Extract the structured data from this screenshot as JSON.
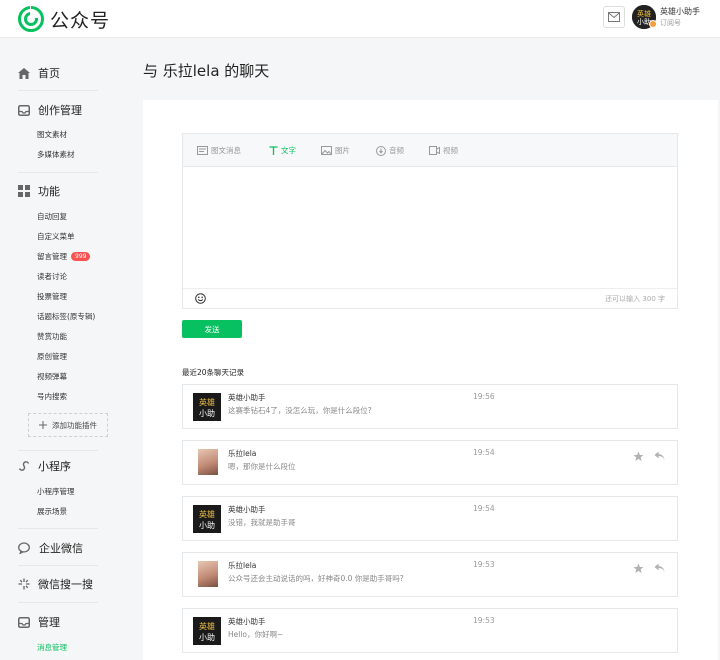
{
  "header": {
    "logo_text": "公众号",
    "account_name": "英雄小助手",
    "account_type": "订阅号",
    "avatar_text": "英雄小助手"
  },
  "sidebar": {
    "home": "首页",
    "create": {
      "title": "创作管理",
      "items": [
        "图文素材",
        "多媒体素材"
      ]
    },
    "features": {
      "title": "功能",
      "items": [
        "自动回复",
        "自定义菜单",
        "留言管理",
        "读者讨论",
        "投票管理",
        "话题标签(原专辑)",
        "赞赏功能",
        "原创管理",
        "视频弹幕",
        "号内搜索"
      ],
      "badge": "999",
      "add_plugin": "添加功能插件"
    },
    "miniprogram": {
      "title": "小程序",
      "items": [
        "小程序管理",
        "展示场景"
      ]
    },
    "wecom": "企业微信",
    "search": "微信搜一搜",
    "manage": {
      "title": "管理",
      "items": [
        "消息管理"
      ]
    }
  },
  "page": {
    "title": "与 乐拉lela 的聊天"
  },
  "editor": {
    "tabs": [
      "图文消息",
      "文字",
      "图片",
      "音频",
      "视频"
    ],
    "active_tab": "文字",
    "counter": "还可以输入 300 字",
    "send_label": "发送"
  },
  "history": {
    "title": "最近20条聊天记录",
    "messages": [
      {
        "sender": "英雄小助手",
        "text": "这赛季钻石4了，没怎么玩，你是什么段位?",
        "time": "19:56",
        "type": "bot"
      },
      {
        "sender": "乐拉lela",
        "text": "嗯，那你是什么段位",
        "time": "19:54",
        "type": "user"
      },
      {
        "sender": "英雄小助手",
        "text": "没错，我就是助手哥",
        "time": "19:54",
        "type": "bot"
      },
      {
        "sender": "乐拉lela",
        "text": "公众号还会主动说话的吗，好神奇0.0 你是助手哥吗?",
        "time": "19:53",
        "type": "user"
      },
      {
        "sender": "英雄小助手",
        "text": "Hello，你好啊~",
        "time": "19:53",
        "type": "bot"
      }
    ]
  },
  "colors": {
    "accent": "#07c160",
    "badge": "#fa5151",
    "text": "#353535",
    "muted": "#999999"
  },
  "icons": {
    "logo": "wechat-logo-icon",
    "mail": "mail-icon",
    "star": "star-icon",
    "reply": "reply-icon",
    "emoji": "emoji-icon"
  }
}
